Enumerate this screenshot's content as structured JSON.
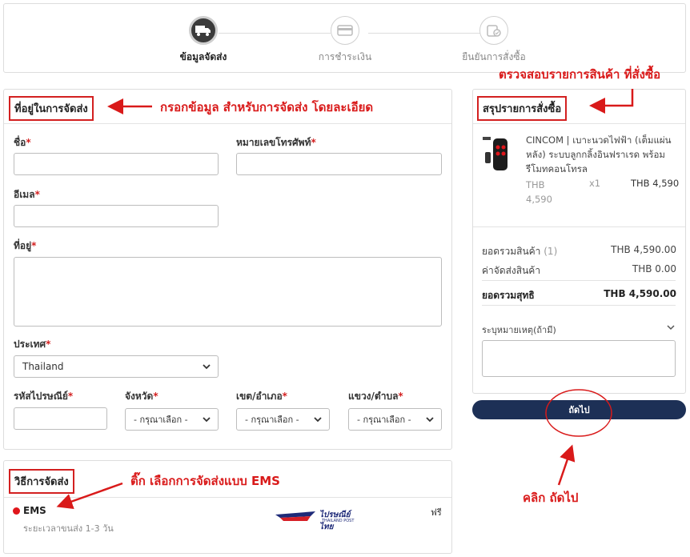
{
  "stepper": {
    "steps": [
      {
        "label": "ข้อมูลจัดส่ง",
        "icon": "truck-icon",
        "active": true
      },
      {
        "label": "การชำระเงิน",
        "icon": "credit-card-icon",
        "active": false
      },
      {
        "label": "ยืนยันการสั่งซื้อ",
        "icon": "confirm-icon",
        "active": false
      }
    ]
  },
  "shipping_form": {
    "title": "ที่อยู่ในการจัดส่ง",
    "name_label": "ชื่อ",
    "phone_label": "หมายเลขโทรศัพท์",
    "email_label": "อีเมล",
    "address_label": "ที่อยู่",
    "country_label": "ประเทศ",
    "country_value": "Thailand",
    "postcode_label": "รหัสไปรษณีย์",
    "province_label": "จังหวัด",
    "district_label": "เขต/อำเภอ",
    "subdistrict_label": "แขวง/ตำบล",
    "select_placeholder": "- กรุณาเลือก -",
    "required_mark": "*"
  },
  "shipping_method": {
    "title": "วิธีการจัดส่ง",
    "option_name": "EMS",
    "option_time": "ระยะเวลาขนส่ง  1-3  วัน",
    "option_price": "ฟรี",
    "carrier_logo_text": "ไปรษณีย์ไทย",
    "carrier_logo_sub": "THAILAND POST",
    "accent_color": "#e0161b"
  },
  "summary": {
    "title": "สรุปรายการสั่งซื้อ",
    "product_name": "CINCOM | เบาะนวดไฟฟ้า (เต็มแผ่นหลัง) ระบบลูกกลิ้งอินฟราเรด พร้อมรีโมทคอนโทรล",
    "unit_price": "THB 4,590",
    "qty": "x1",
    "line_total": "THB 4,590",
    "subtotal_label": "ยอดรวมสินค้า",
    "subtotal_count": "(1)",
    "subtotal_value": "THB 4,590.00",
    "shipping_label": "ค่าจัดส่งสินค้า",
    "shipping_value": "THB 0.00",
    "total_label": "ยอดรวมสุทธิ",
    "total_value": "THB 4,590.00",
    "note_label": "ระบุหมายเหตุ(ถ้ามี)",
    "next_button": "ถัดไป"
  },
  "annotations": {
    "fill_info": "กรอกข้อมูล สำหรับการจัดส่ง โดยละเอียด",
    "check_items": "ตรวจสอบรายการสินค้า ที่สั่งซื้อ",
    "tick_ems": "ติ๊ก เลือกการจัดส่งแบบ EMS",
    "click_next": "คลิก ถัดไป",
    "color": "#d91a1a"
  }
}
